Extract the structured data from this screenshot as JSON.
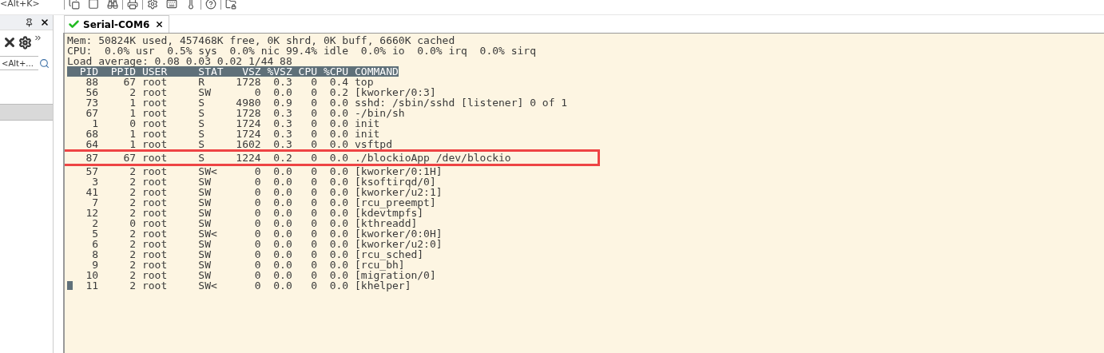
{
  "toolbar": {
    "shortcut_hint": "<Alt+K>"
  },
  "side_panel": {
    "search": {
      "placeholder": "<Alt+..."
    },
    "has_selected_item": true
  },
  "tabs": [
    {
      "label": "Serial-COM6",
      "selected": true,
      "connected": true
    }
  ],
  "terminal": {
    "summary": [
      "Mem: 50824K used, 457468K free, 0K shrd, 0K buff, 6660K cached",
      "CPU:  0.0% usr  0.5% sys  0.0% nic 99.4% idle  0.0% io  0.0% irq  0.0% sirq",
      "Load average: 0.08 0.03 0.02 1/44 88"
    ],
    "header": "  PID  PPID USER     STAT   VSZ %VSZ CPU %CPU COMMAND",
    "rows": [
      {
        "text": "   88    67 root     R     1728  0.3   0  0.4 top",
        "highlighted": false
      },
      {
        "text": "   56     2 root     SW       0  0.0   0  0.2 [kworker/0:3]",
        "highlighted": false
      },
      {
        "text": "   73     1 root     S     4980  0.9   0  0.0 sshd: /sbin/sshd [listener] 0 of 1",
        "highlighted": false
      },
      {
        "text": "   67     1 root     S     1728  0.3   0  0.0 -/bin/sh",
        "highlighted": false
      },
      {
        "text": "    1     0 root     S     1724  0.3   0  0.0 init",
        "highlighted": false
      },
      {
        "text": "   68     1 root     S     1724  0.3   0  0.0 init",
        "highlighted": false
      },
      {
        "text": "   64     1 root     S     1602  0.3   0  0.0 vsftpd",
        "highlighted": false
      },
      {
        "text": "   87    67 root     S     1224  0.2   0  0.0 ./blockioApp /dev/blockio",
        "highlighted": true
      },
      {
        "text": "   57     2 root     SW<      0  0.0   0  0.0 [kworker/0:1H]",
        "highlighted": false
      },
      {
        "text": "    3     2 root     SW       0  0.0   0  0.0 [ksoftirqd/0]",
        "highlighted": false
      },
      {
        "text": "   41     2 root     SW       0  0.0   0  0.0 [kworker/u2:1]",
        "highlighted": false
      },
      {
        "text": "    7     2 root     SW       0  0.0   0  0.0 [rcu_preempt]",
        "highlighted": false
      },
      {
        "text": "   12     2 root     SW       0  0.0   0  0.0 [kdevtmpfs]",
        "highlighted": false
      },
      {
        "text": "    2     0 root     SW       0  0.0   0  0.0 [kthreadd]",
        "highlighted": false
      },
      {
        "text": "    5     2 root     SW<      0  0.0   0  0.0 [kworker/0:0H]",
        "highlighted": false
      },
      {
        "text": "    6     2 root     SW       0  0.0   0  0.0 [kworker/u2:0]",
        "highlighted": false
      },
      {
        "text": "    8     2 root     SW       0  0.0   0  0.0 [rcu_sched]",
        "highlighted": false
      },
      {
        "text": "    9     2 root     SW       0  0.0   0  0.0 [rcu_bh]",
        "highlighted": false
      },
      {
        "text": "   10     2 root     SW       0  0.0   0  0.0 [migration/0]",
        "highlighted": false
      },
      {
        "text": "   11     2 root     SW<      0  0.0   0  0.0 [khelper]",
        "highlighted": false,
        "cursor": true
      }
    ]
  }
}
